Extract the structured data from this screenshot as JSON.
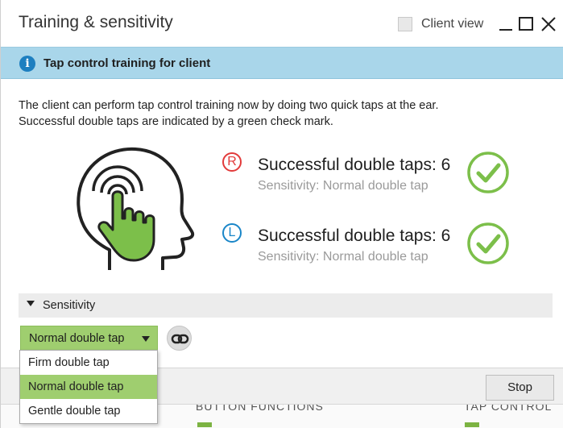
{
  "window": {
    "title": "Training & sensitivity",
    "client_view_label": "Client view",
    "client_view_checked": false
  },
  "banner": {
    "icon": "info-icon",
    "text": "Tap control training for client"
  },
  "description": {
    "line1": "The client can perform tap control training now by doing two quick taps at the ear.",
    "line2": "Successful double taps are indicated by a green check mark."
  },
  "ears": [
    {
      "side": "R",
      "main": "Successful double taps: 6",
      "sub": "Sensitivity: Normal double tap",
      "color": "#e23a3a",
      "status_icon": "check-circle-icon"
    },
    {
      "side": "L",
      "main": "Successful double taps: 6",
      "sub": "Sensitivity: Normal double tap",
      "color": "#1a86c8",
      "status_icon": "check-circle-icon"
    }
  ],
  "sensitivity": {
    "header": "Sensitivity",
    "selected": "Normal double tap",
    "options": [
      "Firm double tap",
      "Normal double tap",
      "Gentle double tap"
    ],
    "link_icon": "link-icon"
  },
  "footer": {
    "stop_label": "Stop"
  },
  "background_tabs": {
    "left": "BUTTON FUNCTIONS",
    "right": "TAP CONTROL"
  },
  "colors": {
    "accent_green": "#9fce6f",
    "check_green": "#7cbf4a",
    "banner_blue": "#a9d6ea",
    "info_blue": "#1d7fc0"
  }
}
